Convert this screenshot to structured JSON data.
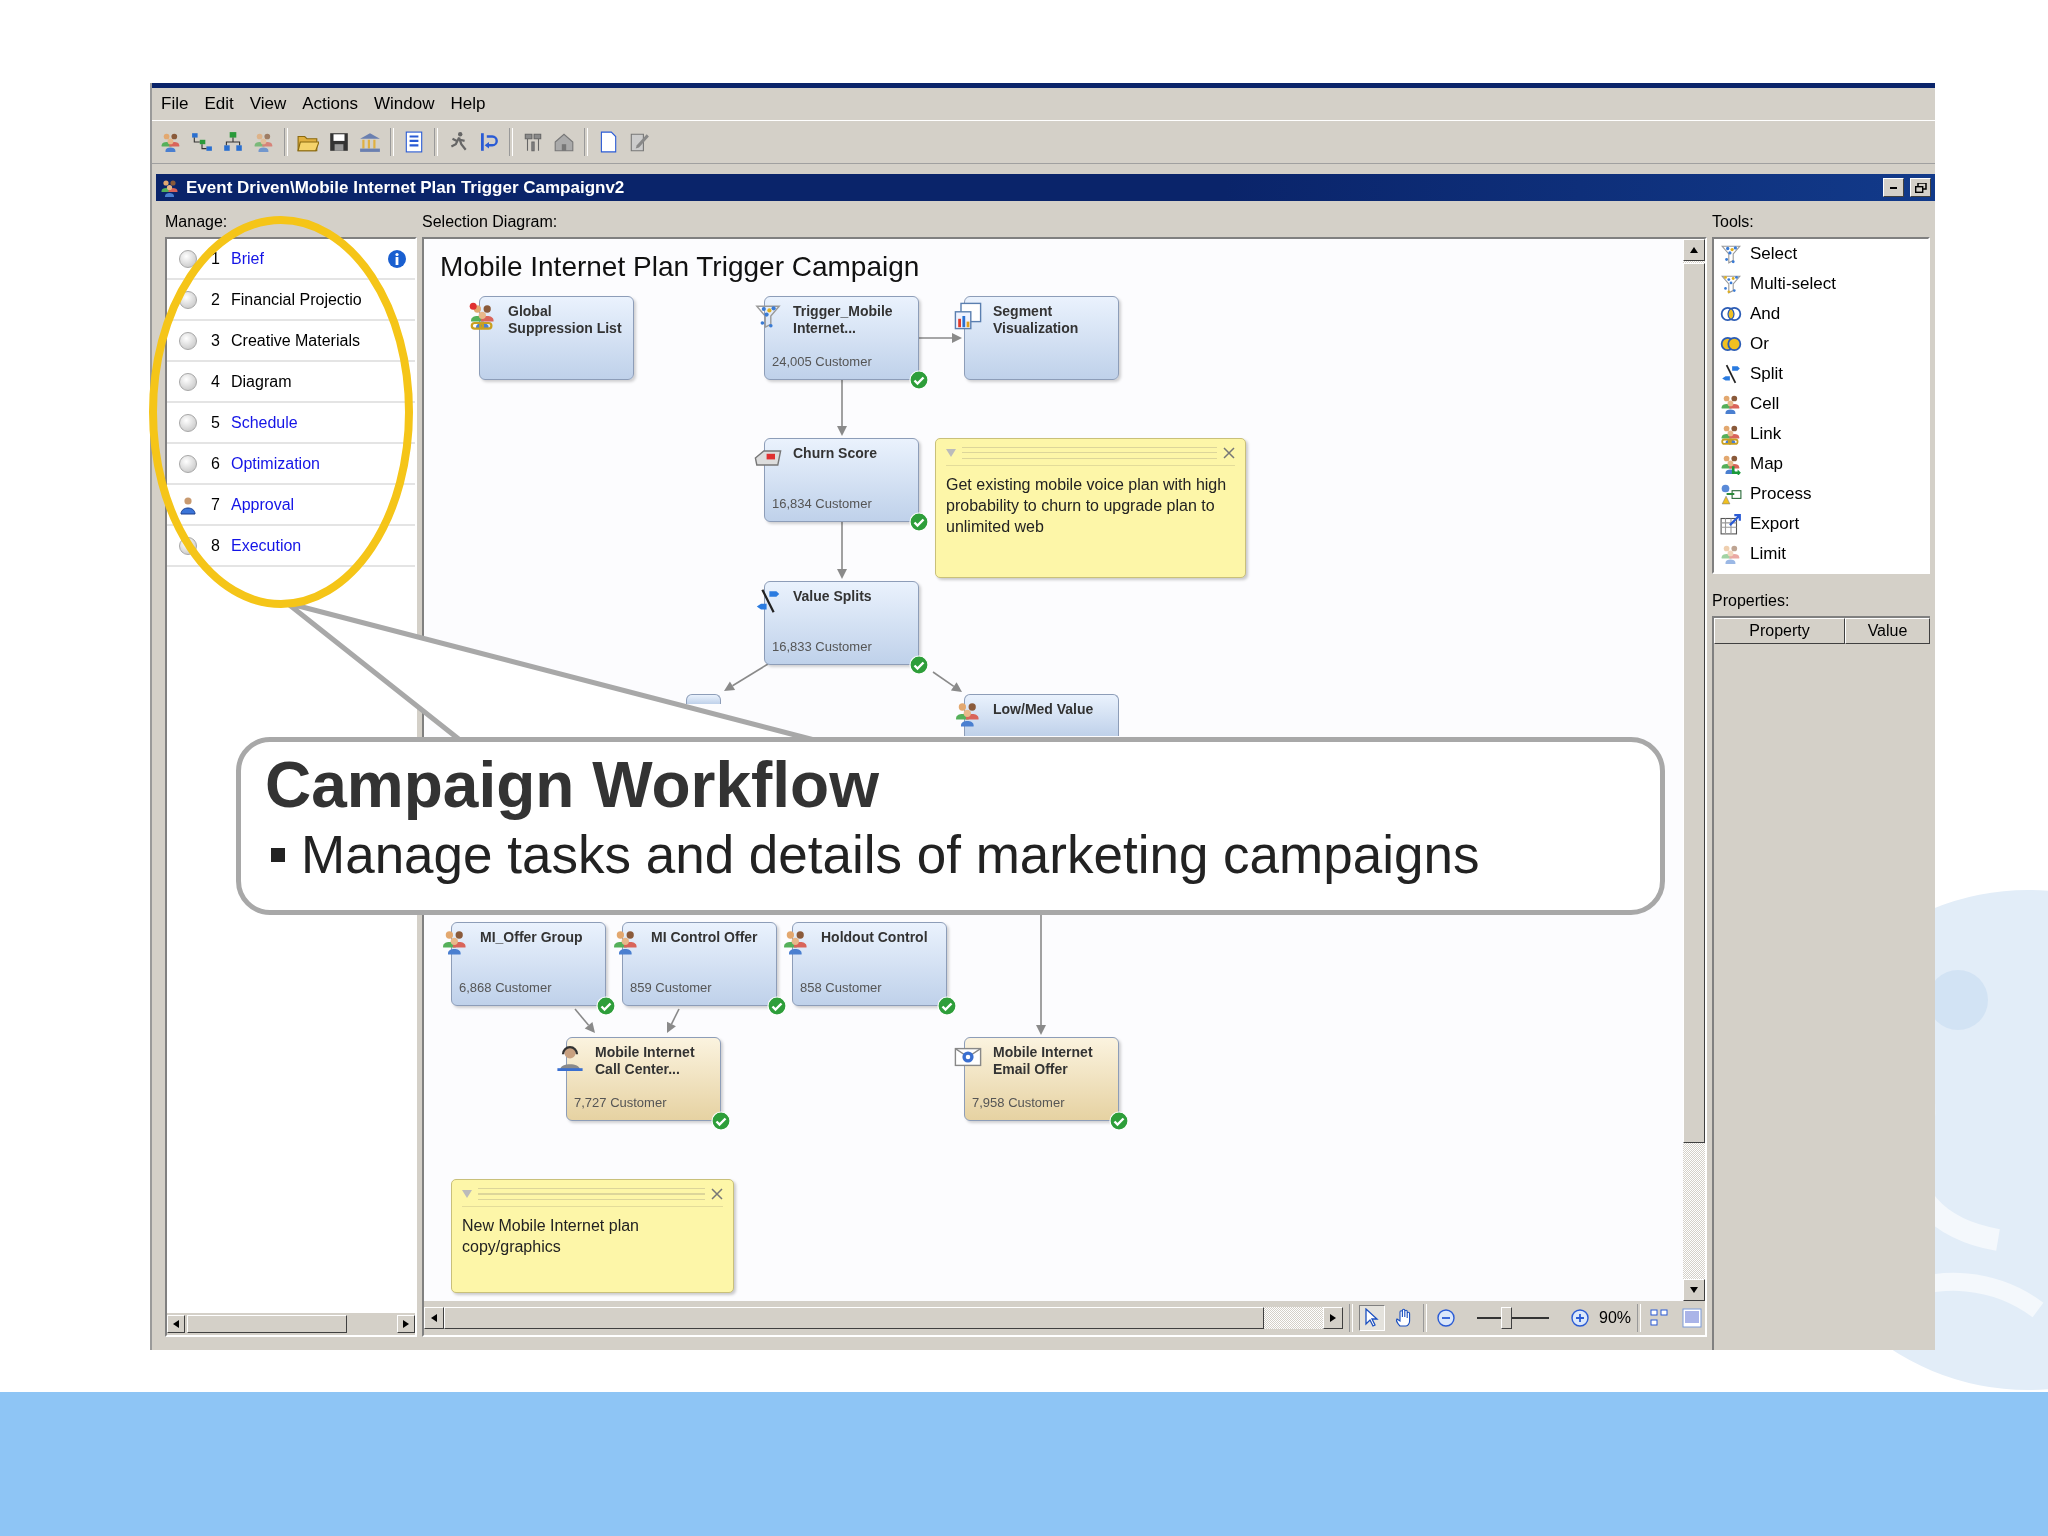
{
  "window": {
    "title": "Event Driven\\Mobile Internet Plan Trigger Campaignv2"
  },
  "menu": [
    "File",
    "Edit",
    "View",
    "Actions",
    "Window",
    "Help"
  ],
  "manage": {
    "label": "Manage:",
    "steps": [
      {
        "number": "1",
        "name": "Brief",
        "linked": true,
        "awaiting_approval": false,
        "info": true
      },
      {
        "number": "2",
        "name": "Financial Projectio",
        "linked": false,
        "awaiting_approval": false,
        "info": false
      },
      {
        "number": "3",
        "name": "Creative Materials",
        "linked": false,
        "awaiting_approval": false,
        "info": false
      },
      {
        "number": "4",
        "name": "Diagram",
        "linked": false,
        "awaiting_approval": false,
        "info": false
      },
      {
        "number": "5",
        "name": "Schedule",
        "linked": true,
        "awaiting_approval": false,
        "info": false
      },
      {
        "number": "6",
        "name": "Optimization",
        "linked": true,
        "awaiting_approval": false,
        "info": false
      },
      {
        "number": "7",
        "name": "Approval",
        "linked": true,
        "awaiting_approval": true,
        "info": false
      },
      {
        "number": "8",
        "name": "Execution",
        "linked": true,
        "awaiting_approval": false,
        "info": false
      }
    ]
  },
  "diagram": {
    "label": "Selection Diagram:",
    "title": "Mobile Internet Plan Trigger Campaign",
    "nodes": [
      {
        "kind": "suppression",
        "output": false,
        "title": "Global Suppression List",
        "done": false
      },
      {
        "kind": "select",
        "output": false,
        "title": "Trigger_Mobile Internet...",
        "count": "24,005 Customer",
        "done": true
      },
      {
        "kind": "chart",
        "output": false,
        "title": "Segment Visualization",
        "done": false
      },
      {
        "kind": "score",
        "output": false,
        "title": "Churn Score",
        "count": "16,834 Customer",
        "done": true
      },
      {
        "kind": "split",
        "output": false,
        "title": "Value Splits",
        "count": "16,833 Customer",
        "done": true
      },
      {
        "kind": "blank",
        "output": false,
        "done": false
      },
      {
        "kind": "cell",
        "output": false,
        "title": "Low/Med Value",
        "done": false
      },
      {
        "kind": "cell",
        "output": false,
        "title": "MI_Offer Group",
        "count": "6,868 Customer",
        "done": true
      },
      {
        "kind": "cell",
        "output": false,
        "title": "MI Control Offer",
        "count": "859 Customer",
        "done": true
      },
      {
        "kind": "cell",
        "output": false,
        "title": "Holdout Control",
        "count": "858 Customer",
        "done": true
      },
      {
        "kind": "call",
        "output": true,
        "title": "Mobile Internet Call Center...",
        "count": "7,727 Customer",
        "done": true
      },
      {
        "kind": "email",
        "output": true,
        "title": "Mobile Internet Email Offer",
        "count": "7,958 Customer",
        "done": true
      }
    ],
    "notes": [
      {
        "text": "Get existing mobile voice plan with high probability to churn to upgrade plan to unlimited web"
      },
      {
        "text": "New Mobile Internet plan copy/graphics"
      }
    ],
    "zoom": {
      "level": 0.4,
      "reading": "90%"
    }
  },
  "tools": {
    "label": "Tools:",
    "items": [
      {
        "kind": "select",
        "label": "Select"
      },
      {
        "kind": "multi_select",
        "label": "Multi-select"
      },
      {
        "kind": "and",
        "label": "And"
      },
      {
        "kind": "or",
        "label": "Or"
      },
      {
        "kind": "split",
        "label": "Split"
      },
      {
        "kind": "cell",
        "label": "Cell"
      },
      {
        "kind": "link",
        "label": "Link"
      },
      {
        "kind": "map",
        "label": "Map"
      },
      {
        "kind": "process",
        "label": "Process"
      },
      {
        "kind": "export",
        "label": "Export"
      },
      {
        "kind": "limit",
        "label": "Limit"
      }
    ]
  },
  "properties": {
    "label": "Properties:",
    "columns": [
      "Property",
      "Value"
    ]
  },
  "callout": {
    "title": "Campaign Workflow",
    "bullets": [
      "Manage tasks and details of marketing campaigns"
    ]
  }
}
